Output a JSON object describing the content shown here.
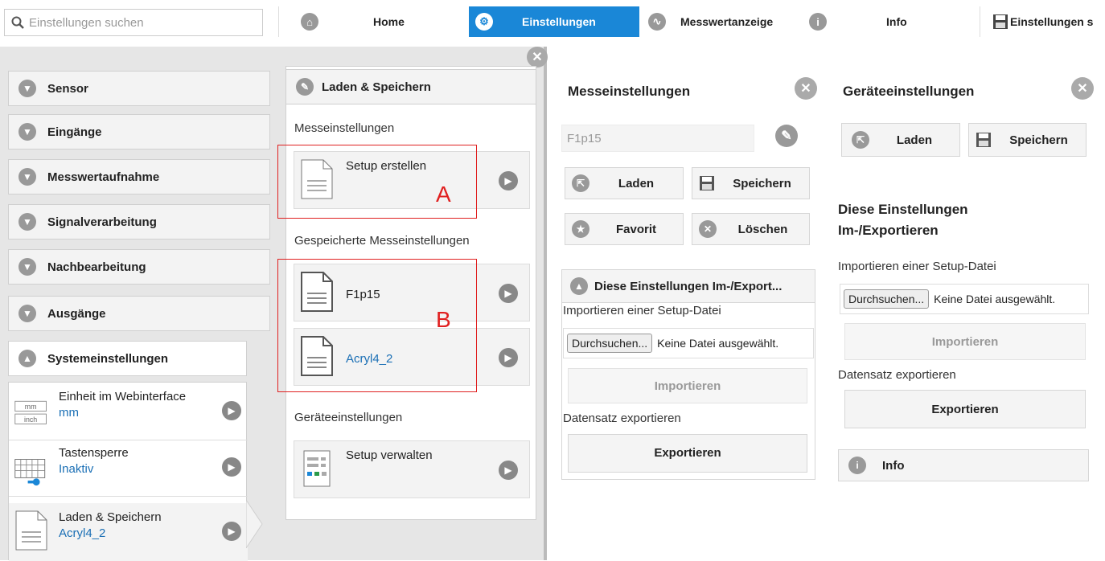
{
  "search": {
    "placeholder": "Einstellungen suchen"
  },
  "nav": {
    "home": "Home",
    "settings": "Einstellungen",
    "measure": "Messwertanzeige",
    "info": "Info",
    "save": "Einstellungen s"
  },
  "categories": [
    {
      "label": "Sensor"
    },
    {
      "label": "Eingänge"
    },
    {
      "label": "Messwertaufnahme"
    },
    {
      "label": "Signalverarbeitung"
    },
    {
      "label": "Nachbearbeitung"
    },
    {
      "label": "Ausgänge"
    },
    {
      "label": "Systemeinstellungen"
    }
  ],
  "system_items": [
    {
      "title": "Einheit im Webinterface",
      "value": "mm",
      "icon_top": "mm",
      "icon_bottom": "inch"
    },
    {
      "title": "Tastensperre",
      "value": "Inaktiv"
    },
    {
      "title": "Laden & Speichern",
      "value": "Acryl4_2"
    }
  ],
  "middle": {
    "header": "Laden & Speichern",
    "section1": "Messeinstellungen",
    "setup_create": "Setup erstellen",
    "section2": "Gespeicherte Messeinstellungen",
    "saved": [
      "F1p15",
      "Acryl4_2"
    ],
    "section3": "Geräteeinstellungen",
    "setup_manage": "Setup verwalten",
    "label_a": "A",
    "label_b": "B"
  },
  "measure_settings": {
    "title": "Messeinstellungen",
    "name_value": "F1p15",
    "load": "Laden",
    "save": "Speichern",
    "favorite": "Favorit",
    "delete": "Löschen",
    "import_header": "Diese Einstellungen Im-/Export...",
    "import_label": "Importieren einer Setup-Datei",
    "browse": "Durchsuchen...",
    "no_file": "Keine Datei ausgewählt.",
    "import_btn": "Importieren",
    "export_label": "Datensatz exportieren",
    "export_btn": "Exportieren"
  },
  "device_settings": {
    "title": "Geräteeinstellungen",
    "load": "Laden",
    "save": "Speichern",
    "ie_title_1": "Diese Einstellungen",
    "ie_title_2": "Im-/Exportieren",
    "import_label": "Importieren einer Setup-Datei",
    "browse": "Durchsuchen...",
    "no_file": "Keine Datei ausgewählt.",
    "import_btn": "Importieren",
    "export_label": "Datensatz exportieren",
    "export_btn": "Exportieren",
    "info": "Info"
  },
  "colors": {
    "accent": "#1a87d7",
    "link": "#1a6fb5",
    "annotation": "#e02020"
  }
}
